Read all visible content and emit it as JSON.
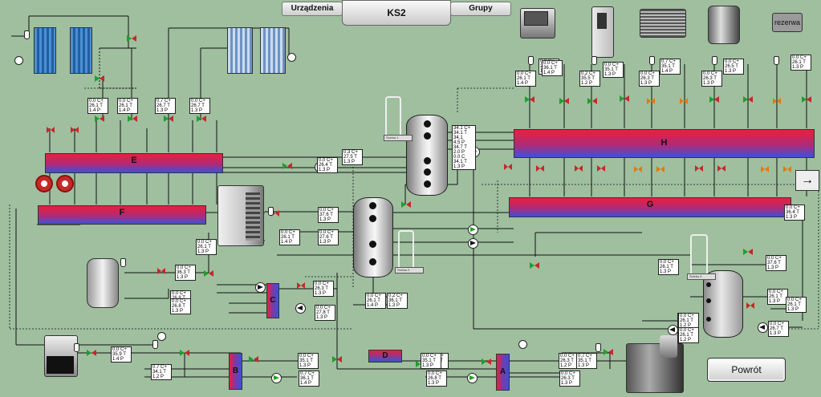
{
  "tabs": {
    "devices": "Urządzenia",
    "main": "KS2",
    "groups": "Grupy"
  },
  "headers": {
    "E": "E",
    "F": "F",
    "G": "G",
    "H": "H"
  },
  "exchangers": {
    "A": "A",
    "B": "B",
    "C": "C",
    "D": "D"
  },
  "reserve_label": "rezerwa",
  "back_button": "Powrót",
  "nav_arrow": "→",
  "buffer_tags": [
    "Ścieka 1",
    "Ścieka 2",
    "Ścieka 3"
  ],
  "readouts": [
    [
      "0.0 C+",
      "26.1 T",
      "1.4 P"
    ],
    [
      "0.0 C+",
      "26.1 T",
      "1.4 P"
    ],
    [
      "0.7 C+",
      "26.7 T",
      "1.3 P"
    ],
    [
      "0.0 C+",
      "26.7 T",
      "1.3 P"
    ],
    [
      "0.3 C+",
      "27.5 T",
      "1.3 P"
    ],
    [
      "0.0 C+",
      "26.4 T",
      "1.3 P"
    ],
    [
      "0.0 C+",
      "37.6 T",
      "1.3 P"
    ],
    [
      "0.0 C+",
      "27.6 T",
      "1.3 P"
    ],
    [
      "0.0 C+",
      "26.1 T",
      "1.4 P"
    ],
    [
      "0.0 C+",
      "26.1 T",
      "1.3 P"
    ],
    [
      "0.0 C+",
      "36.3 T",
      "1.3 P"
    ],
    [
      "0.0 C+",
      "26.3 T",
      "1.3 P"
    ],
    [
      "0.0 C+",
      "27.8 T",
      "1.3 P"
    ],
    [
      "0.0 C+",
      "26.8 T",
      "1.3 P"
    ],
    [
      "0.0 C+",
      "26.8 T",
      "1.3 P"
    ],
    [
      "0.0 C+",
      "35.9 T",
      "1.4 P"
    ],
    [
      "0.7 C+",
      "34.1 T",
      "1.2 P"
    ],
    [
      "0.0 C+",
      "26.1 T",
      "1.4 P"
    ],
    [
      "0.2 C+",
      "36.1 T",
      "1.3 P"
    ],
    [
      "0.0 C+",
      "35.1 T",
      "1.3 P"
    ],
    [
      "0.7 C+",
      "36.1 T",
      "1.4 P"
    ],
    [
      "0.0 C+",
      "36.3 T",
      "1.4 P"
    ],
    [
      "0.0 C+",
      "26.8 T",
      "1.3 P"
    ],
    [
      "0.0 C+",
      "26.3 T",
      "1.2 P"
    ],
    [
      "0.0 C+",
      "26.3 T",
      "1.3 P"
    ],
    [
      "0.0 C+",
      "26.1 T",
      "1.3 P"
    ],
    [
      "0.0 C+",
      "35.1 T",
      "1.3 P"
    ],
    [
      "0.7 C+",
      "35.1 T",
      "1.4 P"
    ],
    [
      "0.0 C+",
      "26.5 T",
      "1.3 P"
    ],
    [
      "0.0 C+",
      "26.1 T",
      "1.3 P"
    ],
    [
      "0.0 C+",
      "26.3 T",
      "1.3 P"
    ],
    [
      "0.0 C+",
      "37.6 T",
      "1.3 P"
    ],
    [
      "0.0 C+",
      "26.1 T",
      "1.3 P"
    ],
    [
      "0.0 C+",
      "35.1 T",
      "1.4 P"
    ],
    [
      "0.0 C+",
      "26.1 T",
      "1.3 P"
    ],
    [
      "0.0 C+",
      "26.1 T",
      "1.3 P"
    ],
    [
      "0.0 C+",
      "26.1 T",
      "1.3 P"
    ],
    [
      "0.0 C+",
      "26.7 T",
      "1.3 P"
    ],
    [
      "0.0 C+",
      "36.4 T",
      "1.3 P"
    ],
    [
      "0.0 C+",
      "35.1 T",
      "1.3 P"
    ],
    [
      "0.0 C+",
      "26.3 T",
      "1.3 P"
    ],
    [
      "0.2 C+",
      "35.5 T",
      "1.2 P"
    ],
    [
      "0.0 C+",
      "26.1 T",
      "1.4 P"
    ],
    [
      "0.0 C+",
      "36.1 T",
      "1.4 P"
    ],
    [
      "0.7 C+",
      "35.1 T",
      "1.3 P"
    ],
    [
      "0.0 C+",
      "26.1 T",
      "1.2 P"
    ],
    [
      "0.0 C+",
      "26.1 T",
      "1.2 P"
    ]
  ],
  "buffer_tank_readouts": [
    [
      "34.1 C+",
      "34.1 T",
      "34.1",
      "4.5 P",
      "34.7 T",
      "2.0 P",
      "0.0 C",
      "34.1 T",
      "1.3 P"
    ]
  ],
  "colors": {
    "background": "#9fbf9f",
    "hot": "#e8203c",
    "cold": "#3a52d8"
  }
}
